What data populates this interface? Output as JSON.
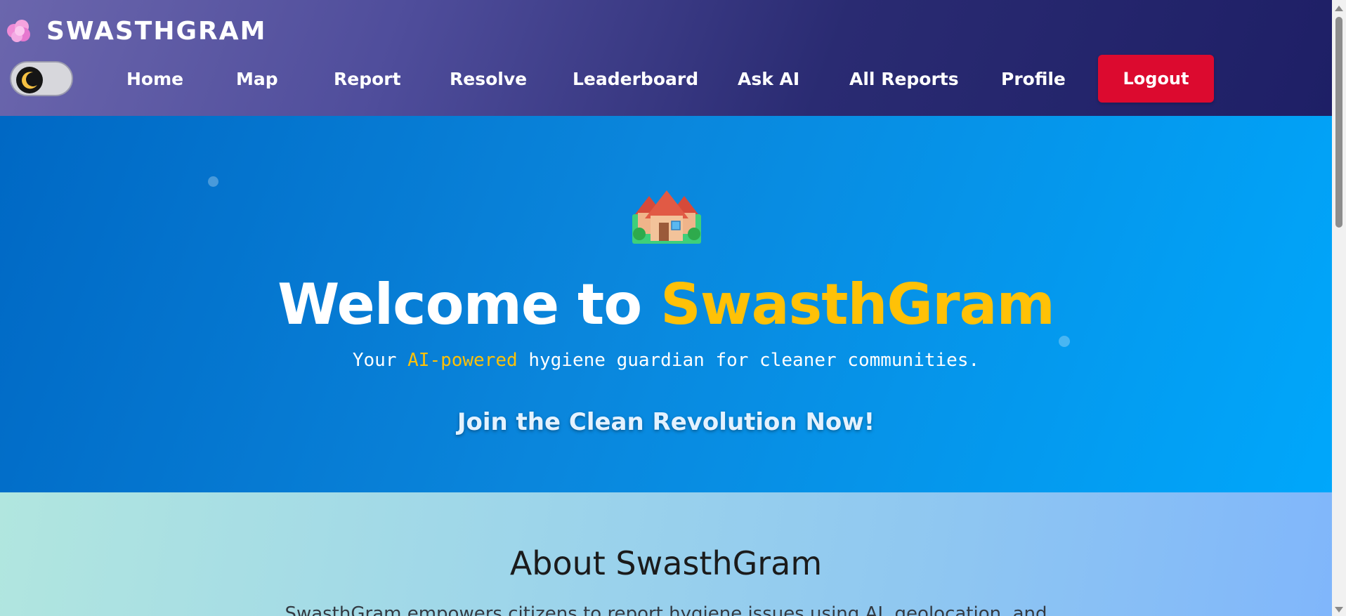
{
  "brand": {
    "title": "SWASTHGRAM",
    "icon": "cloud-blob-icon"
  },
  "theme_toggle": {
    "icon": "moon-icon",
    "state": "dark-mode-off"
  },
  "nav": {
    "links": [
      {
        "label": "Home"
      },
      {
        "label": "Map"
      },
      {
        "label": "Report"
      },
      {
        "label": "Resolve"
      },
      {
        "label": "Leaderboard"
      },
      {
        "label": "Ask AI"
      },
      {
        "label": "All Reports"
      },
      {
        "label": "Profile"
      }
    ],
    "logout_label": "Logout"
  },
  "hero": {
    "icon": "houses-icon",
    "title_prefix": "Welcome to ",
    "title_accent": "SwasthGram",
    "subtitle_pre": "Your ",
    "subtitle_accent": "AI-powered",
    "subtitle_post": " hygiene guardian for cleaner communities.",
    "cta": "Join the Clean Revolution Now!"
  },
  "about": {
    "title": "About SwasthGram",
    "text": "SwasthGram empowers citizens to report hygiene issues using AI, geolocation, and"
  },
  "colors": {
    "accent": "#ffc107",
    "logout": "#dc0a2f",
    "nav_start": "#6b66ad",
    "nav_end": "#1e1f66",
    "hero_start": "#0068c4",
    "hero_end": "#00a7fb"
  }
}
